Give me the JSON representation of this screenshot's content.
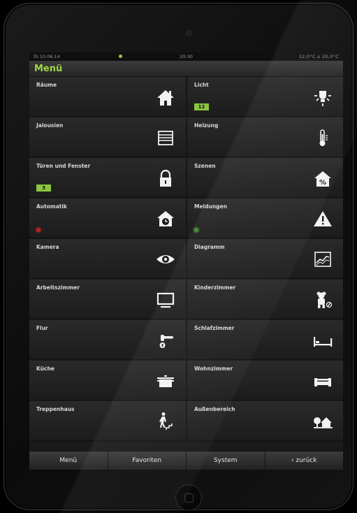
{
  "status": {
    "date": "Di 10.06.14",
    "time": "20:30",
    "temps": "12,0°C  ⌂ 20,0°C"
  },
  "title": "Menü",
  "tiles": [
    {
      "label": "Räume",
      "icon": "house-icon"
    },
    {
      "label": "Licht",
      "badge": "12",
      "icon": "light-bulb-icon"
    },
    {
      "label": "Jalousien",
      "icon": "blinds-icon"
    },
    {
      "label": "Heizung",
      "icon": "thermometer-icon"
    },
    {
      "label": "Türen und Fenster",
      "badge": "3",
      "icon": "lock-icon"
    },
    {
      "label": "Szenen",
      "icon": "scene-house-percent-icon"
    },
    {
      "label": "Automatik",
      "led": "red",
      "icon": "house-clock-icon"
    },
    {
      "label": "Meldungen",
      "led": "green",
      "icon": "warning-icon"
    },
    {
      "label": "Kamera",
      "icon": "eye-icon"
    },
    {
      "label": "Diagramm",
      "icon": "chart-icon"
    },
    {
      "label": "Arbeitszimmer",
      "icon": "monitor-icon"
    },
    {
      "label": "Kinderzimmer",
      "icon": "teddy-bear-icon"
    },
    {
      "label": "Flur",
      "icon": "door-handle-icon"
    },
    {
      "label": "Schlafzimmer",
      "icon": "bed-icon"
    },
    {
      "label": "Küche",
      "icon": "cooking-pot-icon"
    },
    {
      "label": "Wohnzimmer",
      "icon": "sofa-icon"
    },
    {
      "label": "Treppenhaus",
      "icon": "stairs-person-icon"
    },
    {
      "label": "Außenbereich",
      "icon": "outdoor-trees-house-icon"
    }
  ],
  "nav": {
    "menu": "Menü",
    "favorites": "Favoriten",
    "system": "System",
    "back": "‹ zurück"
  },
  "colors": {
    "accent": "#9fd34a",
    "badge": "#8cc63f"
  }
}
